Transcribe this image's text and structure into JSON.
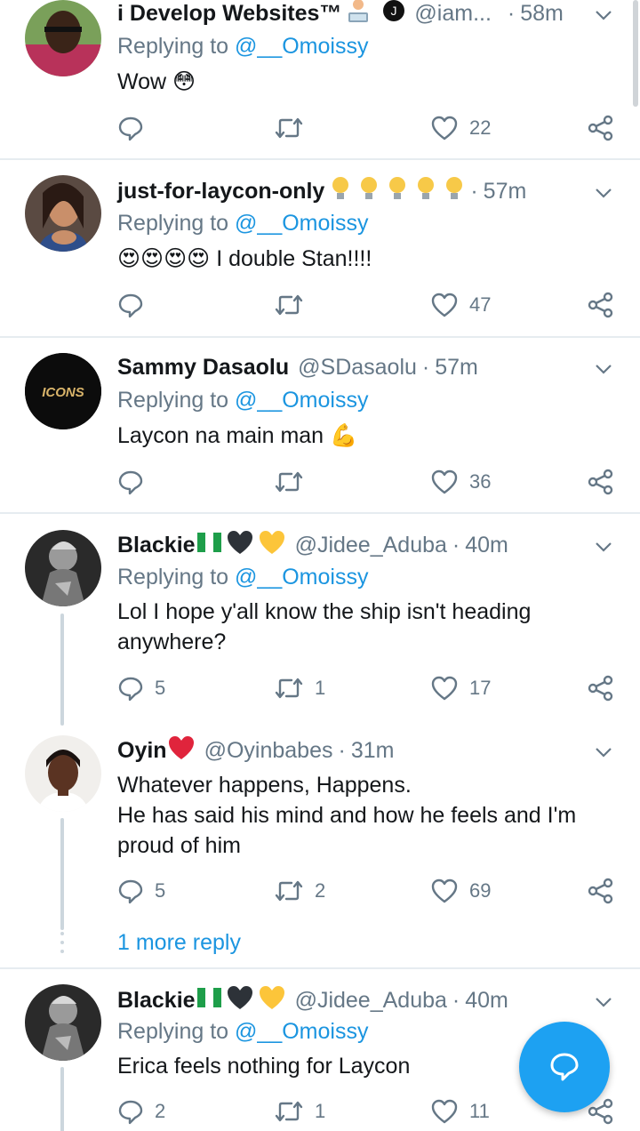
{
  "tweets": [
    {
      "name": "i Develop Websites™",
      "handle": "@iam...",
      "time": "58m",
      "replying_prefix": "Replying to",
      "replying_to": "@__Omoissy",
      "text_lines": [
        "Wow 😳"
      ],
      "reply_count": "",
      "retweet_count": "",
      "like_count": "22"
    },
    {
      "name": "just-for-laycon-only",
      "name_emojis": "💡💡💡💡💡",
      "handle": "",
      "time": "57m",
      "replying_prefix": "Replying to",
      "replying_to": "@__Omoissy",
      "text_lines": [
        "😍😍😍😍 I double Stan!!!!"
      ],
      "reply_count": "",
      "retweet_count": "",
      "like_count": "47"
    },
    {
      "name": "Sammy Dasaolu",
      "handle": "@SDasaolu",
      "time": "57m",
      "replying_prefix": "Replying to",
      "replying_to": "@__Omoissy",
      "avatar_text": "ICONS",
      "text_lines": [
        "Laycon na main man 💪"
      ],
      "reply_count": "",
      "retweet_count": "",
      "like_count": "36"
    },
    {
      "name": "Blackie",
      "name_emojis": "🇳🇬🖤💛",
      "handle": "@Jidee_Aduba",
      "time": "40m",
      "replying_prefix": "Replying to",
      "replying_to": "@__Omoissy",
      "text_lines": [
        "Lol I hope y'all know the ship isn't heading",
        "anywhere?"
      ],
      "reply_count": "5",
      "retweet_count": "1",
      "like_count": "17"
    },
    {
      "name": "Oyin",
      "name_emojis": "❤️",
      "handle": "@Oyinbabes",
      "time": "31m",
      "text_lines": [
        "Whatever happens, Happens.",
        "He has said his mind and how he feels and I'm",
        "proud of him"
      ],
      "reply_count": "5",
      "retweet_count": "2",
      "like_count": "69"
    },
    {
      "name": "Blackie",
      "name_emojis": "🇳🇬🖤💛",
      "handle": "@Jidee_Aduba",
      "time": "40m",
      "replying_prefix": "Replying to",
      "replying_to": "@__Omoissy",
      "text_lines": [
        "Erica feels nothing for Laycon"
      ],
      "reply_count": "2",
      "retweet_count": "1",
      "like_count": "11"
    }
  ],
  "more_replies": "1 more reply",
  "colors": {
    "accent": "#1da1f2",
    "link": "#1b95e0",
    "muted": "#657786",
    "divider": "#e6ecf0"
  },
  "icons": [
    "reply-icon",
    "retweet-icon",
    "like-icon",
    "share-icon",
    "chevron-down-icon",
    "compose-icon"
  ]
}
